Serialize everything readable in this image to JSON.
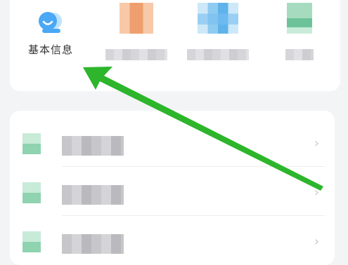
{
  "shortcuts": [
    {
      "label": "基本信息",
      "icon": "profile-avatar-icon"
    },
    {
      "label": "",
      "icon": "orange-shortcut-icon"
    },
    {
      "label": "",
      "icon": "blue-shortcut-icon"
    },
    {
      "label": "",
      "icon": "green-shortcut-icon"
    }
  ],
  "list": {
    "items": [
      {
        "label": "",
        "icon": "list-item-icon"
      },
      {
        "label": "",
        "icon": "list-item-icon"
      },
      {
        "label": "",
        "icon": "list-item-icon"
      }
    ]
  },
  "colors": {
    "accent_blue": "#4aa8f5",
    "annotation_green": "#2db52b"
  }
}
